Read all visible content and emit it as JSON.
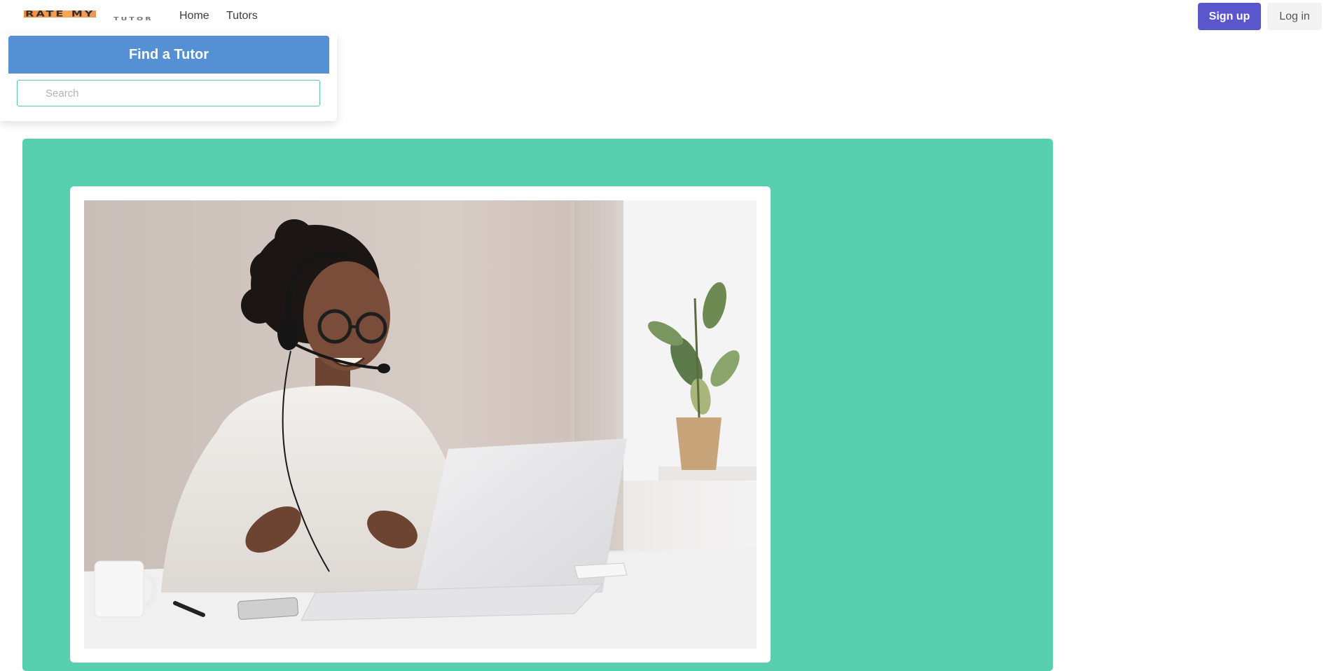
{
  "navbar": {
    "logo": {
      "main_text": "RATE MY",
      "sub_text": "TUTOR"
    },
    "links": [
      {
        "label": "Home"
      },
      {
        "label": "Tutors"
      }
    ],
    "signup_label": "Sign up",
    "login_label": "Log in"
  },
  "finder": {
    "title": "Find a Tutor",
    "search_placeholder": "Search"
  },
  "hero": {
    "background_color": "#58d0b0",
    "image_icon": "photo-of-woman-with-headset-at-laptop"
  },
  "colors": {
    "primary": "#5a57cc",
    "finder_header": "#558fd4",
    "accent": "#58d0b0"
  }
}
